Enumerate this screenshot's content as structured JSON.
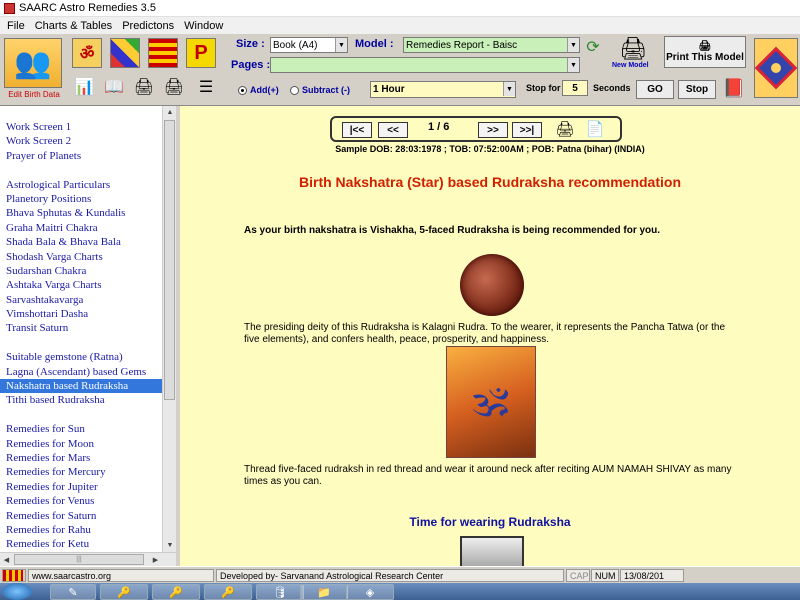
{
  "window": {
    "title": "SAARC Astro Remedies 3.5"
  },
  "menu": [
    "File",
    "Charts & Tables",
    "Predictons",
    "Window"
  ],
  "toolbar": {
    "edit_birth_label": "Edit Birth Data",
    "size_label": "Size :",
    "size_value": "Book (A4)",
    "model_label": "Model :",
    "model_value": "Remedies Report - Baisc",
    "pages_label": "Pages :",
    "pages_value": "",
    "new_model_label": "New Model",
    "print_model_label": "Print This Model",
    "add_label": "Add(+)",
    "subtract_label": "Subtract (-)",
    "interval_value": "1 Hour",
    "stop_for_label": "Stop for",
    "stop_for_value": "5",
    "seconds_label": "Seconds",
    "go_label": "GO",
    "stop_label": "Stop",
    "icon_letters": {
      "om": "ॐ",
      "p": "P"
    }
  },
  "sidebar": {
    "items": [
      {
        "label": "Work Screen 1"
      },
      {
        "label": "Work Screen 2"
      },
      {
        "label": "Prayer of Planets"
      },
      {
        "label": ""
      },
      {
        "label": "Astrological Particulars"
      },
      {
        "label": "Planetory Positions"
      },
      {
        "label": "Bhava Sphutas & Kundalis"
      },
      {
        "label": "Graha Maitri Chakra"
      },
      {
        "label": "Shada Bala & Bhava Bala"
      },
      {
        "label": "Shodash Varga Charts"
      },
      {
        "label": "Sudarshan Chakra"
      },
      {
        "label": "Ashtaka Varga Charts"
      },
      {
        "label": "Sarvashtakavarga"
      },
      {
        "label": "Vimshottari Dasha"
      },
      {
        "label": "Transit Saturn"
      },
      {
        "label": ""
      },
      {
        "label": "Suitable gemstone (Ratna)"
      },
      {
        "label": "Lagna (Ascendant) based Gems"
      },
      {
        "label": "Nakshatra based Rudraksha",
        "selected": true
      },
      {
        "label": "Tithi based Rudraksha"
      },
      {
        "label": ""
      },
      {
        "label": "Remedies for Sun"
      },
      {
        "label": "Remedies for Moon"
      },
      {
        "label": "Remedies for Mars"
      },
      {
        "label": "Remedies for Mercury"
      },
      {
        "label": "Remedies for Jupiter"
      },
      {
        "label": "Remedies for Venus"
      },
      {
        "label": "Remedies for Saturn"
      },
      {
        "label": "Remedies for Rahu"
      },
      {
        "label": "Remedies for Ketu"
      }
    ]
  },
  "report": {
    "nav": {
      "first": "|<<",
      "prev": "<<",
      "page": "1 / 6",
      "next": ">>",
      "last": ">>|"
    },
    "sample": "Sample  DOB: 28:03:1978 ; TOB: 07:52:00AM ; POB: Patna (bihar) (INDIA)",
    "heading": "Birth Nakshatra (Star) based Rudraksha recommendation",
    "intro": "As your birth nakshatra is Vishakha, 5-faced Rudraksha is being recommended for you.",
    "deity": "The presiding deity of this Rudraksha is Kalagni Rudra. To the wearer, it represents the Pancha Tatwa (or the five elements), and confers health, peace, prosperity, and happiness.",
    "instruction": "Thread five-faced rudraksh in red thread and wear it around neck after reciting AUM NAMAH SHIVAY as many times as you can.",
    "subheading": "Time for wearing Rudraksha"
  },
  "status": {
    "website": "www.saarcastro.org",
    "developer": "Developed by- Sarvanand Astrological Research Center",
    "caps": "CAP",
    "num": "NUM",
    "date": "13/08/201"
  },
  "colors": {
    "report_bg": "#fffcc0",
    "heading": "#d02000",
    "link": "#1a1aa8",
    "selected": "#3377dd"
  }
}
